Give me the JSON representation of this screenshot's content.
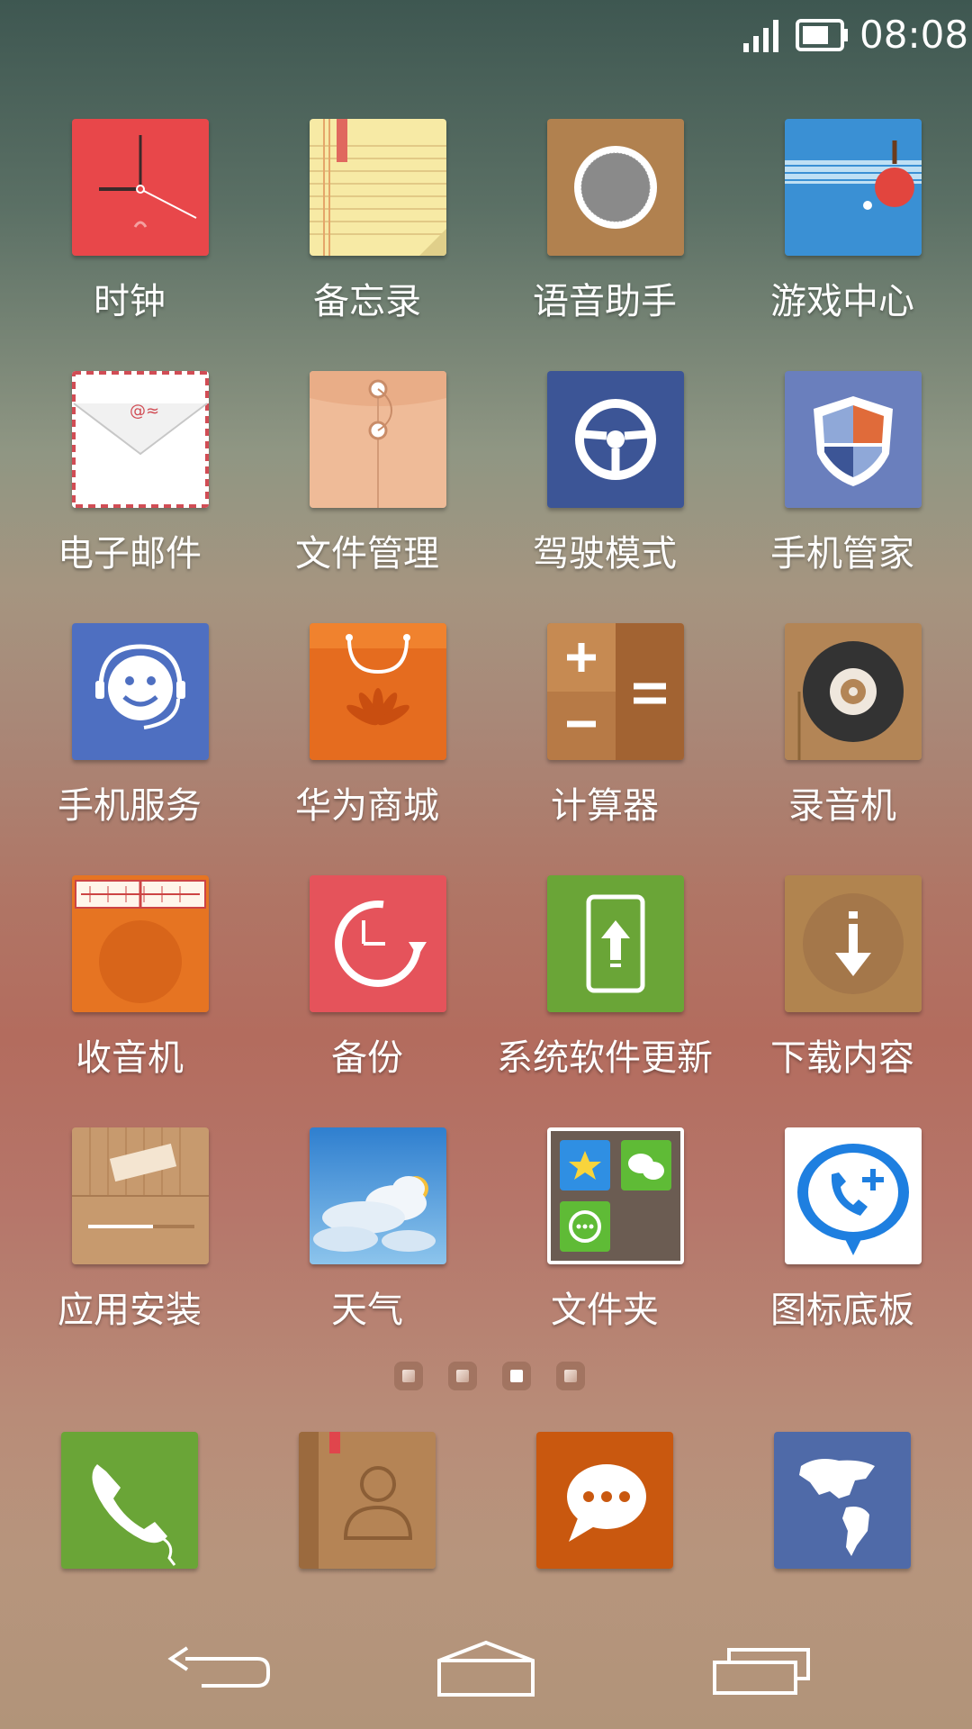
{
  "status_bar": {
    "time": "08:08",
    "icons": [
      "signal-icon",
      "battery-icon"
    ]
  },
  "apps": [
    {
      "label": "时钟",
      "icon": "clock-icon",
      "color": "#e8474a"
    },
    {
      "label": "备忘录",
      "icon": "notepad-icon",
      "color": "#f7eaa5"
    },
    {
      "label": "语音助手",
      "icon": "microphone-icon",
      "color": "#b1814f"
    },
    {
      "label": "游戏中心",
      "icon": "ping-pong-icon",
      "color": "#3a90d4"
    },
    {
      "label": "电子邮件",
      "icon": "envelope-icon",
      "color": "#ffffff"
    },
    {
      "label": "文件管理",
      "icon": "folder-envelope-icon",
      "color": "#efbb98"
    },
    {
      "label": "驾驶模式",
      "icon": "steering-wheel-icon",
      "color": "#3c5596"
    },
    {
      "label": "手机管家",
      "icon": "shield-icon",
      "color": "#6a7fbd"
    },
    {
      "label": "手机服务",
      "icon": "headset-smile-icon",
      "color": "#4e6fc1"
    },
    {
      "label": "华为商城",
      "icon": "shopping-bag-icon",
      "color": "#e56c1f"
    },
    {
      "label": "计算器",
      "icon": "calculator-icon",
      "color": "#a26332"
    },
    {
      "label": "录音机",
      "icon": "tape-reel-icon",
      "color": "#b38556"
    },
    {
      "label": "收音机",
      "icon": "radio-icon",
      "color": "#e67422"
    },
    {
      "label": "备份",
      "icon": "backup-clock-icon",
      "color": "#e5535b"
    },
    {
      "label": "系统软件更新",
      "icon": "phone-upload-icon",
      "color": "#6aa537"
    },
    {
      "label": "下载内容",
      "icon": "download-arrow-icon",
      "color": "#b1844f"
    },
    {
      "label": "应用安装",
      "icon": "app-package-icon",
      "color": "#c79a6e"
    },
    {
      "label": "天气",
      "icon": "weather-cloud-sun-icon",
      "color": "#3f8fd3"
    },
    {
      "label": "文件夹",
      "icon": "folder-icon",
      "color": "#6b5c52"
    },
    {
      "label": "图标底板",
      "icon": "call-plus-bubble-icon",
      "color": "#ffffff"
    }
  ],
  "page_indicator": {
    "pages": 4,
    "current": 3
  },
  "dock": [
    {
      "name": "phone",
      "icon": "phone-icon",
      "color": "#6aa537"
    },
    {
      "name": "contacts",
      "icon": "contacts-book-icon",
      "color": "#b58455"
    },
    {
      "name": "messaging",
      "icon": "chat-bubble-icon",
      "color": "#c9580f"
    },
    {
      "name": "browser",
      "icon": "globe-map-icon",
      "color": "#4f6aa8"
    }
  ],
  "nav_bar": {
    "icons": [
      "back-icon",
      "home-icon",
      "recent-apps-icon"
    ]
  }
}
